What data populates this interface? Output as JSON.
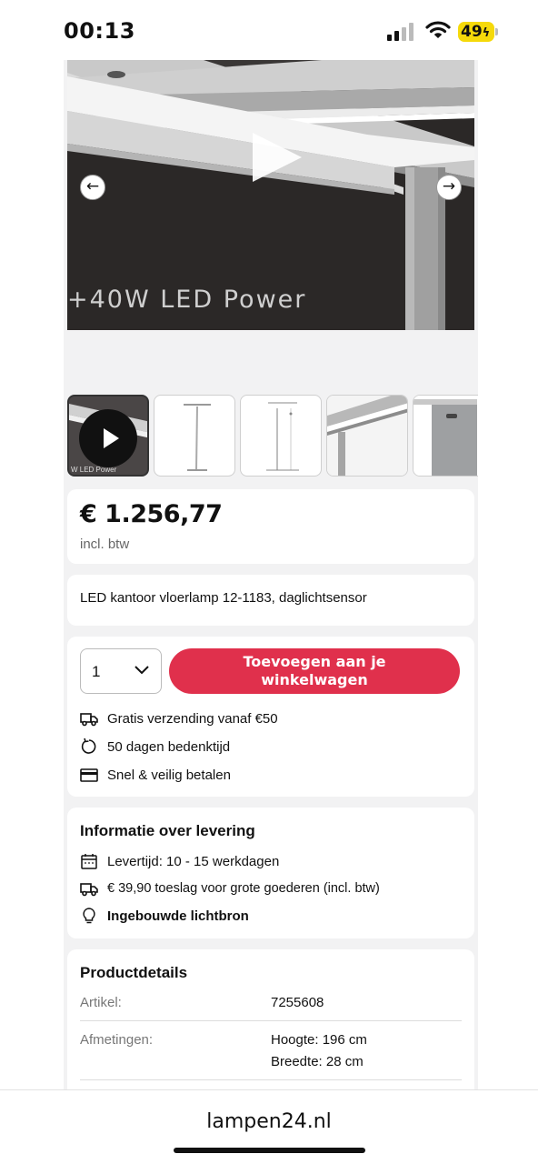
{
  "status_bar": {
    "time": "00:13",
    "battery": "49"
  },
  "gallery": {
    "video_caption": "+40W LED Power",
    "thumb_caption": "W LED Power",
    "prev_arrow": "←",
    "next_arrow": "→"
  },
  "product": {
    "price": "€ 1.256,77",
    "price_note": "incl. btw",
    "title": "LED kantoor vloerlamp 12-1183, daglichtsensor"
  },
  "cart": {
    "quantity": "1",
    "add_button_line1": "Toevoegen aan je",
    "add_button_line2": "winkelwagen"
  },
  "benefits": [
    {
      "icon": "truck-icon",
      "text": "Gratis verzending vanaf €50"
    },
    {
      "icon": "return-icon",
      "text": "50 dagen bedenktijd"
    },
    {
      "icon": "card-icon",
      "text": "Snel & veilig betalen"
    }
  ],
  "delivery": {
    "title": "Informatie over levering",
    "lead_time": "Levertijd: 10 - 15 werkdagen",
    "surcharge": "€ 39,90  toeslag voor grote goederen (incl. btw)",
    "light_source": "Ingebouwde lichtbron"
  },
  "details": {
    "title": "Productdetails",
    "article_label": "Artikel:",
    "article_value": "7255608",
    "dimensions_label": "Afmetingen:",
    "height_value": "Hoogte: 196 cm",
    "width_value": "Breedte: 28 cm"
  },
  "browser": {
    "url": "lampen24.nl"
  },
  "colors": {
    "accent": "#e0304c",
    "battery": "#f5d90a",
    "background": "#f2f2f3"
  }
}
